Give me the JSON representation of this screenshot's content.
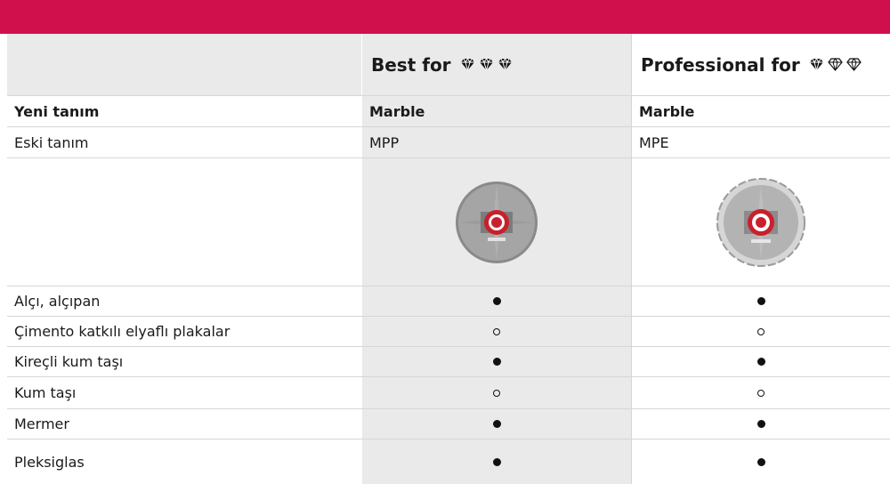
{
  "colors": {
    "brand_bar": "#d0104c",
    "shaded_column": "#eaeaea",
    "divider": "#d6d6d6",
    "blade_core": "#c9202c"
  },
  "header": {
    "col1_label": "Best for",
    "col1_diamonds": [
      "filled",
      "filled",
      "filled"
    ],
    "col2_label": "Professional for",
    "col2_diamonds": [
      "filled",
      "outline",
      "outline"
    ]
  },
  "rows": {
    "yeni_tanim": {
      "label": "Yeni tanım",
      "best": "Marble",
      "professional": "Marble"
    },
    "eski_tanim": {
      "label": "Eski tanım",
      "best": "MPP",
      "professional": "MPE"
    },
    "images": {
      "best": "diamond-blade-mpp-icon",
      "professional": "diamond-blade-mpe-icon"
    },
    "materials": [
      {
        "label": "Alçı, alçıpan",
        "best": "filled",
        "professional": "filled"
      },
      {
        "label": "Çimento katkılı elyaflı plakalar",
        "best": "outline",
        "professional": "outline"
      },
      {
        "label": "Kireçli kum taşı",
        "best": "filled",
        "professional": "filled"
      },
      {
        "label": "Kum taşı",
        "best": "outline",
        "professional": "outline"
      },
      {
        "label": "Mermer",
        "best": "filled",
        "professional": "filled"
      },
      {
        "label": "Pleksiglas",
        "best": "filled",
        "professional": "filled"
      }
    ]
  }
}
